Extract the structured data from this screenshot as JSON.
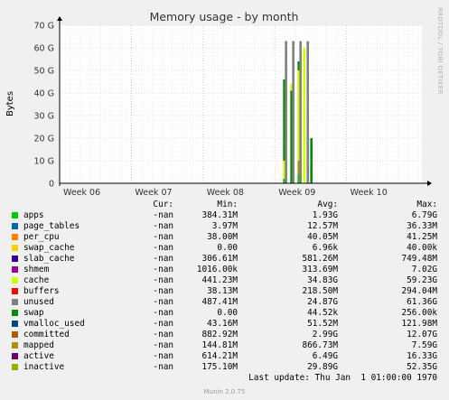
{
  "chart_data": {
    "type": "area",
    "title": "Memory usage - by month",
    "ylabel": "Bytes",
    "xlabel": "",
    "ylim": [
      0,
      70
    ],
    "yunit": "G",
    "yticks": [
      0,
      10,
      20,
      30,
      40,
      50,
      60,
      70
    ],
    "ytick_labels": [
      "0",
      "10 G",
      "20 G",
      "30 G",
      "40 G",
      "50 G",
      "60 G",
      "70 G"
    ],
    "x_ticks": [
      "Week 06",
      "Week 07",
      "Week 08",
      "Week 09",
      "Week 10"
    ],
    "grid": true,
    "stacked": true,
    "series_note": "Data appears only in a short span inside Week 08.",
    "spikes": [
      {
        "x": 0.62,
        "stack": [
          {
            "series": "apps",
            "value": 2
          },
          {
            "series": "cache",
            "value": 8
          },
          {
            "series": "swap",
            "value": 36
          }
        ]
      },
      {
        "x": 0.625,
        "stack": [
          {
            "series": "unused",
            "value": 63
          }
        ]
      },
      {
        "x": 0.64,
        "stack": [
          {
            "series": "swap",
            "value": 41
          },
          {
            "series": "cache",
            "value": 3
          }
        ]
      },
      {
        "x": 0.645,
        "stack": [
          {
            "series": "unused",
            "value": 63
          }
        ]
      },
      {
        "x": 0.66,
        "stack": [
          {
            "series": "apps",
            "value": 4
          },
          {
            "series": "mapped",
            "value": 6
          },
          {
            "series": "cache",
            "value": 40
          },
          {
            "series": "swap",
            "value": 4
          }
        ]
      },
      {
        "x": 0.665,
        "stack": [
          {
            "series": "unused",
            "value": 63
          }
        ]
      },
      {
        "x": 0.675,
        "stack": [
          {
            "series": "cache",
            "value": 60
          }
        ]
      },
      {
        "x": 0.685,
        "stack": [
          {
            "series": "unused",
            "value": 63
          }
        ]
      },
      {
        "x": 0.695,
        "stack": [
          {
            "series": "swap",
            "value": 20
          }
        ]
      }
    ]
  },
  "legend": {
    "headers": {
      "cur": "Cur:",
      "min": "Min:",
      "avg": "Avg:",
      "max": "Max:"
    },
    "rows": [
      {
        "name": "apps",
        "color": "#00cc00",
        "cur": "-nan",
        "min": "384.31M",
        "avg": "1.93G",
        "max": "6.79G"
      },
      {
        "name": "page_tables",
        "color": "#0066b3",
        "cur": "-nan",
        "min": "3.97M",
        "avg": "12.57M",
        "max": "36.33M"
      },
      {
        "name": "per_cpu",
        "color": "#ff8000",
        "cur": "-nan",
        "min": "38.00M",
        "avg": "40.05M",
        "max": "41.25M"
      },
      {
        "name": "swap_cache",
        "color": "#ffcc00",
        "cur": "-nan",
        "min": "0.00",
        "avg": "6.96k",
        "max": "40.00k"
      },
      {
        "name": "slab_cache",
        "color": "#330099",
        "cur": "-nan",
        "min": "306.61M",
        "avg": "581.26M",
        "max": "749.48M"
      },
      {
        "name": "shmem",
        "color": "#990099",
        "cur": "-nan",
        "min": "1016.00k",
        "avg": "313.69M",
        "max": "7.02G"
      },
      {
        "name": "cache",
        "color": "#ccff00",
        "cur": "-nan",
        "min": "441.23M",
        "avg": "34.83G",
        "max": "59.23G"
      },
      {
        "name": "buffers",
        "color": "#ff0000",
        "cur": "-nan",
        "min": "38.13M",
        "avg": "218.50M",
        "max": "294.04M"
      },
      {
        "name": "unused",
        "color": "#808080",
        "cur": "-nan",
        "min": "487.41M",
        "avg": "24.87G",
        "max": "61.36G"
      },
      {
        "name": "swap",
        "color": "#008f00",
        "cur": "-nan",
        "min": "0.00",
        "avg": "44.52k",
        "max": "256.00k"
      },
      {
        "name": "vmalloc_used",
        "color": "#00487d",
        "cur": "-nan",
        "min": "43.16M",
        "avg": "51.52M",
        "max": "121.98M"
      },
      {
        "name": "committed",
        "color": "#b35a00",
        "cur": "-nan",
        "min": "882.92M",
        "avg": "2.99G",
        "max": "12.07G"
      },
      {
        "name": "mapped",
        "color": "#b38f00",
        "cur": "-nan",
        "min": "144.81M",
        "avg": "866.73M",
        "max": "7.59G"
      },
      {
        "name": "active",
        "color": "#6b006b",
        "cur": "-nan",
        "min": "614.21M",
        "avg": "6.49G",
        "max": "16.33G"
      },
      {
        "name": "inactive",
        "color": "#8fb300",
        "cur": "-nan",
        "min": "175.10M",
        "avg": "29.89G",
        "max": "52.35G"
      }
    ]
  },
  "footer": {
    "last_update": "Last update: Thu Jan  1 01:00:00 1970"
  },
  "credit": "Munin 2.0.75",
  "side_label": "RRDTOOL / TOBI OETIKER",
  "colors": {
    "background": "#f0f0f0",
    "plot": "#ffffff",
    "grid_major": "#ff9999",
    "grid_minor": "#e0e0e0",
    "axis": "#000000"
  }
}
